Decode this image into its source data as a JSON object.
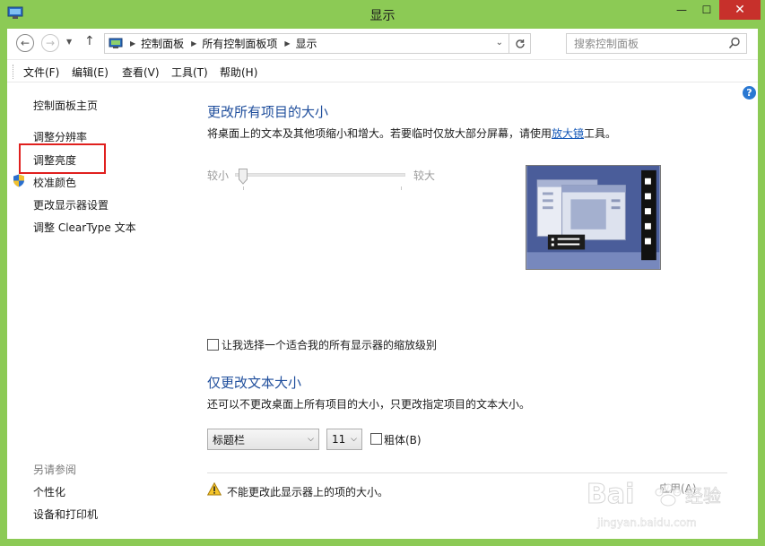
{
  "window": {
    "title": "显示",
    "minimize_label": "—",
    "maximize_label": "☐",
    "close_label": "✕"
  },
  "address": {
    "crumbs": [
      "控制面板",
      "所有控制面板项",
      "显示"
    ],
    "search_placeholder": "搜索控制面板"
  },
  "menu": {
    "items": [
      "文件(F)",
      "编辑(E)",
      "查看(V)",
      "工具(T)",
      "帮助(H)"
    ]
  },
  "help_label": "?",
  "sidebar": {
    "home": "控制面板主页",
    "links": [
      "调整分辨率",
      "调整亮度",
      "校准颜色",
      "更改显示器设置",
      "调整 ClearType 文本"
    ],
    "see_also_title": "另请参阅",
    "see_also": [
      "个性化",
      "设备和打印机"
    ]
  },
  "main": {
    "size_heading": "更改所有项目的大小",
    "size_desc_before": "将桌面上的文本及其他项缩小和增大。若要临时仅放大部分屏幕，请使用",
    "size_desc_link": "放大镜",
    "size_desc_after": "工具。",
    "slider_small": "较小",
    "slider_large": "较大",
    "slider_level": 0,
    "custom_scale_label": "让我选择一个适合我的所有显示器的缩放级别",
    "custom_scale_checked": false,
    "text_heading": "仅更改文本大小",
    "text_desc": "还可以不更改桌面上所有项目的大小，只更改指定项目的文本大小。",
    "item_select_value": "标题栏",
    "size_select_value": "11",
    "bold_label": "粗体(B)",
    "bold_checked": false,
    "warning_text": "不能更改此显示器上的项的大小。",
    "apply_label": "应用(A)"
  },
  "watermark": {
    "brand": "Bai",
    "brand_suffix": "经验",
    "url": "jingyan.baidu.com"
  },
  "colors": {
    "window_frame": "#8cca55",
    "close_button": "#c7302b",
    "heading": "#1f4e9c",
    "link": "#1458b8",
    "highlight": "#e0201e"
  }
}
